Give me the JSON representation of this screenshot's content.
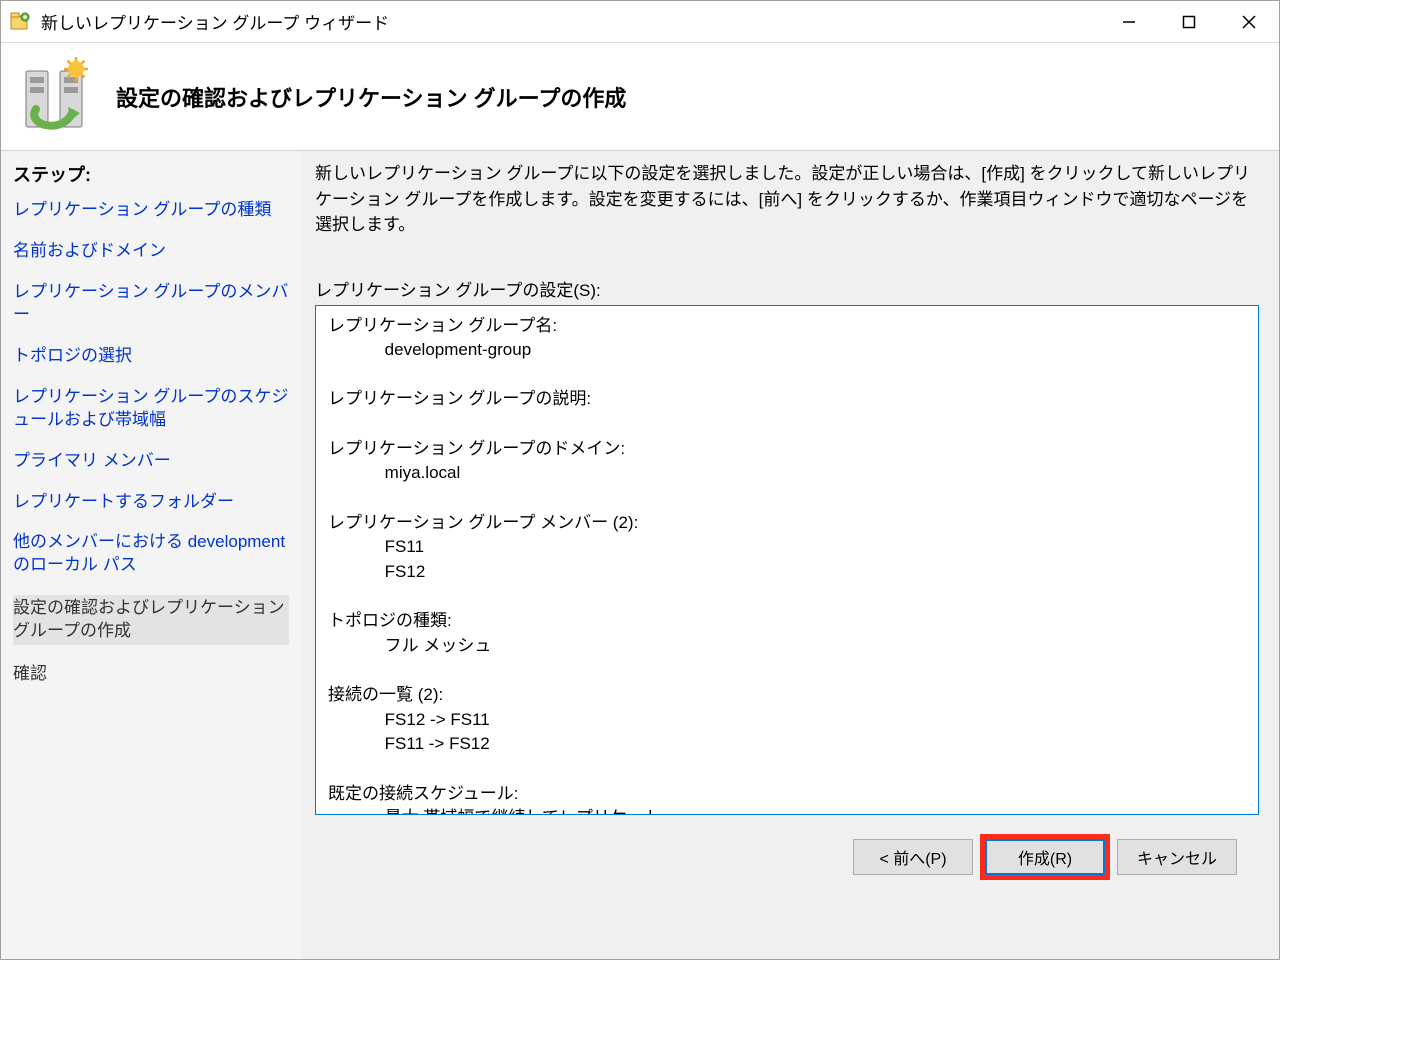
{
  "window": {
    "title": "新しいレプリケーション グループ ウィザード"
  },
  "banner": {
    "title": "設定の確認およびレプリケーション グループの作成"
  },
  "sidebar": {
    "heading": "ステップ:",
    "steps": [
      {
        "label": "レプリケーション グループの種類",
        "state": "link"
      },
      {
        "label": "名前およびドメイン",
        "state": "link"
      },
      {
        "label": "レプリケーション グループのメンバー",
        "state": "link"
      },
      {
        "label": "トポロジの選択",
        "state": "link"
      },
      {
        "label": "レプリケーション グループのスケジュールおよび帯域幅",
        "state": "link"
      },
      {
        "label": "プライマリ メンバー",
        "state": "link"
      },
      {
        "label": "レプリケートするフォルダー",
        "state": "link"
      },
      {
        "label": "他のメンバーにおける development のローカル パス",
        "state": "link"
      },
      {
        "label": "設定の確認およびレプリケーション グループの作成",
        "state": "current"
      },
      {
        "label": "確認",
        "state": "done"
      }
    ]
  },
  "main": {
    "instruction": "新しいレプリケーション グループに以下の設定を選択しました。設定が正しい場合は、[作成] をクリックして新しいレプリケーション グループを作成します。設定を変更するには、[前へ] をクリックするか、作業項目ウィンドウで適切なページを選択します。",
    "settings_label": "レプリケーション グループの設定(S):",
    "settings": {
      "group_name_label": "レプリケーション グループ名:",
      "group_name_value": "development-group",
      "description_label": "レプリケーション グループの説明:",
      "description_value": "",
      "domain_label": "レプリケーション グループのドメイン:",
      "domain_value": "miya.local",
      "members_label": "レプリケーション グループ メンバー (2):",
      "members": [
        "FS11",
        "FS12"
      ],
      "topology_label": "トポロジの種類:",
      "topology_value": "フル メッシュ",
      "connections_label": "接続の一覧 (2):",
      "connections": [
        "FS12 -> FS11",
        "FS11 -> FS12"
      ],
      "schedule_label": "既定の接続スケジュール:",
      "schedule_value": "最大 帯域幅で継続してレプリケート"
    }
  },
  "buttons": {
    "back": "< 前へ(P)",
    "create": "作成(R)",
    "cancel": "キャンセル"
  }
}
